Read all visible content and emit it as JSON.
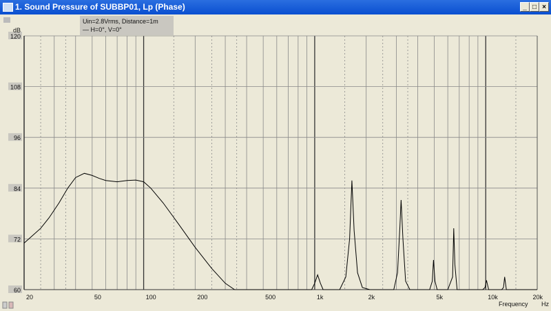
{
  "window": {
    "title": "1. Sound Pressure of SUBBP01, Lp (Phase)",
    "minimize": "_",
    "maximize": "□",
    "close": "×"
  },
  "legend": {
    "line1": "Uin=2.8Vrms, Distance=1m",
    "line2": "H=0°, V=0°"
  },
  "chart_data": {
    "type": "line",
    "title": "Sound Pressure of SUBBP01, Lp (Phase)",
    "xlabel": "Frequency",
    "xunit": "Hz",
    "ylabel": "dB",
    "xscale": "log",
    "xlim": [
      20,
      20000
    ],
    "ylim": [
      60,
      120
    ],
    "yticks": [
      60,
      72,
      84,
      96,
      108,
      120
    ],
    "xticks": [
      {
        "v": 20,
        "l": "20"
      },
      {
        "v": 50,
        "l": "50"
      },
      {
        "v": 100,
        "l": "100"
      },
      {
        "v": 200,
        "l": "200"
      },
      {
        "v": 500,
        "l": "500"
      },
      {
        "v": 1000,
        "l": "1k"
      },
      {
        "v": 2000,
        "l": "2k"
      },
      {
        "v": 5000,
        "l": "5k"
      },
      {
        "v": 10000,
        "l": "10k"
      },
      {
        "v": 20000,
        "l": "20k"
      }
    ],
    "grid": true,
    "series": [
      {
        "name": "H=0°, V=0°",
        "x": [
          20,
          22,
          25,
          28,
          32,
          36,
          40,
          45,
          50,
          55,
          60,
          70,
          80,
          90,
          100,
          110,
          130,
          160,
          200,
          250,
          300,
          340,
          900,
          960,
          1000,
          1040,
          1080,
          1120,
          1400,
          1520,
          1600,
          1650,
          1700,
          1780,
          1900,
          2100,
          2900,
          3050,
          3150,
          3200,
          3280,
          3400,
          3600,
          4700,
          4870,
          4950,
          5050,
          5200,
          6000,
          6400,
          6500,
          6600,
          6800,
          9600,
          9900,
          10100,
          10400,
          12400,
          12700,
          12900,
          13200,
          20000
        ],
        "y": [
          71,
          72.5,
          74.5,
          77,
          80.5,
          84,
          86.5,
          87.5,
          87,
          86.3,
          85.8,
          85.5,
          85.8,
          85.9,
          85.5,
          84,
          80.5,
          75.5,
          70,
          65,
          61.5,
          60,
          60,
          60,
          61.5,
          63.5,
          61.5,
          60,
          60,
          63,
          72,
          85.8,
          74,
          64,
          60.5,
          60,
          60,
          64,
          75,
          81.2,
          72,
          62,
          60,
          60,
          62,
          67,
          62,
          60,
          60,
          63,
          74.5,
          66,
          60,
          60,
          60.5,
          62.2,
          60,
          60,
          60.5,
          63,
          60,
          60
        ]
      }
    ]
  },
  "axis": {
    "ylabel": "dB",
    "xlabel": "Frequency",
    "xunit": "Hz"
  }
}
